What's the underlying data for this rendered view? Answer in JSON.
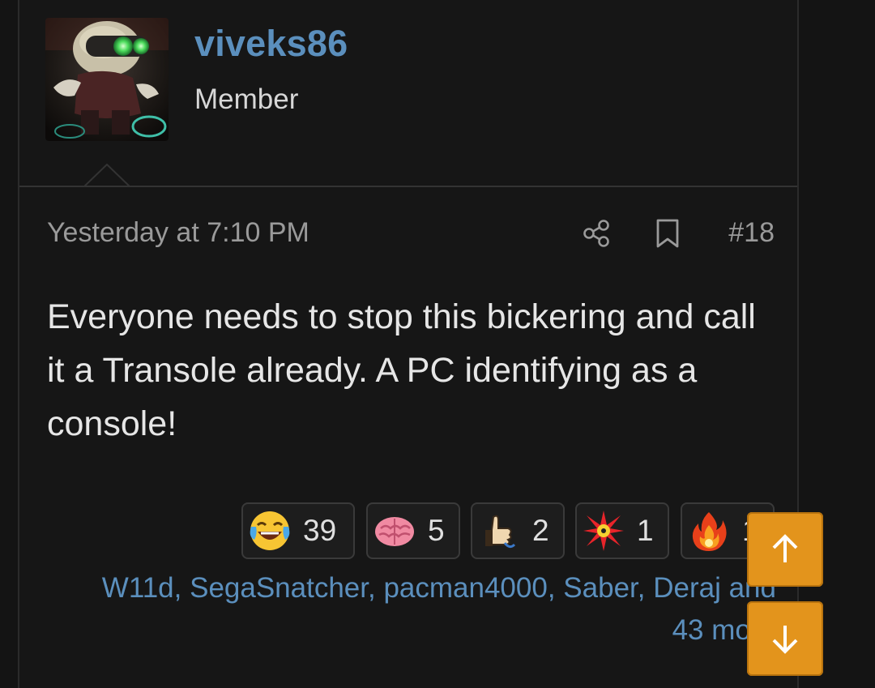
{
  "user": {
    "name": "viveks86",
    "title": "Member"
  },
  "post": {
    "time": "Yesterday at 7:10 PM",
    "number": "#18",
    "body": "Everyone needs to stop this bickering and call it a Transole already. A PC identifying as a console!"
  },
  "reactions": [
    {
      "icon": "laughing-tears-emoji",
      "count": "39"
    },
    {
      "icon": "brain-emoji",
      "count": "5"
    },
    {
      "icon": "thumbs-up-emoji",
      "count": "2"
    },
    {
      "icon": "radiation-burst-emoji",
      "count": "1"
    },
    {
      "icon": "fire-emoji",
      "count": "1"
    }
  ],
  "reactors": {
    "names": [
      "W11d",
      "SegaSnatcher",
      "pacman4000",
      "Saber",
      "Deraj"
    ],
    "and": "and",
    "more": "43 more"
  },
  "colors": {
    "link": "#5b8fbd",
    "accent": "#e3941c",
    "background": "#161616"
  }
}
